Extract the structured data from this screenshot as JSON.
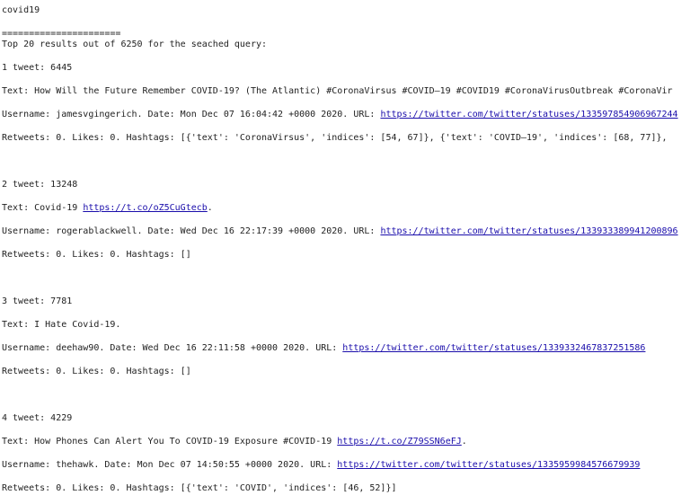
{
  "query": "covid19",
  "separator": "======================",
  "summary": "Top 20 results out of 6250 for the seached query:",
  "results": [
    {
      "header": "1 tweet: 6445",
      "text_prefix": "Text: ",
      "text": "How Will the Future Remember COVID-19? (The Atlantic) #CoronaVirsus #COVID—19 #COVID19 #CoronaVirusOutbreak #CoronaVir",
      "text_link": "",
      "text_suffix": "",
      "meta_prefix": "Username: jamesvgingerich. Date: Mon Dec 07 16:04:42 +0000 2020. URL: ",
      "url": "https://twitter.com/twitter/statuses/133597854906967244",
      "stats": "Retweets: 0. Likes: 0. Hashtags: [{'text': 'CoronaVirsus', 'indices': [54, 67]}, {'text': 'COVID—19', 'indices': [68, 77]},"
    },
    {
      "header": "2 tweet: 13248",
      "text_prefix": "Text: ",
      "text": "Covid-19 ",
      "text_link": "https://t.co/oZ5CuGtecb",
      "text_suffix": ".",
      "meta_prefix": "Username: rogerablackwell. Date: Wed Dec 16 22:17:39 +0000 2020. URL: ",
      "url": "https://twitter.com/twitter/statuses/133933389941200896",
      "stats": "Retweets: 0. Likes: 0. Hashtags: []"
    },
    {
      "header": "3 tweet: 7781",
      "text_prefix": "Text: ",
      "text": "I Hate Covid-19.",
      "text_link": "",
      "text_suffix": "",
      "meta_prefix": "Username: deehaw90. Date: Wed Dec 16 22:11:58 +0000 2020. URL: ",
      "url": "https://twitter.com/twitter/statuses/1339332467837251586",
      "stats": "Retweets: 0. Likes: 0. Hashtags: []"
    },
    {
      "header": "4 tweet: 4229",
      "text_prefix": "Text: ",
      "text": "How Phones Can Alert You To COVID-19 Exposure #COVID-19 ",
      "text_link": "https://t.co/Z79SSN6eFJ",
      "text_suffix": ".",
      "meta_prefix": "Username: thehawk. Date: Mon Dec 07 14:50:55 +0000 2020. URL: ",
      "url": "https://twitter.com/twitter/statuses/1335959984576679939",
      "stats": "Retweets: 0. Likes: 0. Hashtags: [{'text': 'COVID', 'indices': [46, 52]}]"
    }
  ]
}
